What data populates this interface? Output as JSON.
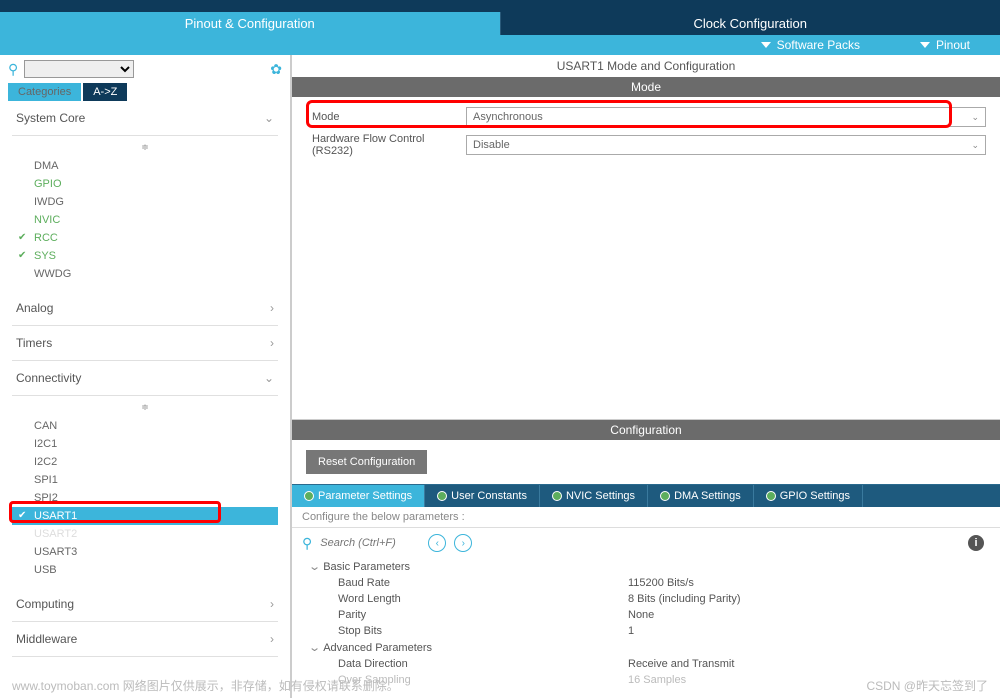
{
  "tabs": {
    "pinout": "Pinout & Configuration",
    "clock": "Clock Configuration"
  },
  "subbar": {
    "packs": "Software Packs",
    "pinout": "Pinout"
  },
  "viewtabs": {
    "categories": "Categories",
    "az": "A->Z"
  },
  "tree": {
    "system_core": "System Core",
    "items_sc": {
      "dma": "DMA",
      "gpio": "GPIO",
      "iwdg": "IWDG",
      "nvic": "NVIC",
      "rcc": "RCC",
      "sys": "SYS",
      "wwdg": "WWDG"
    },
    "analog": "Analog",
    "timers": "Timers",
    "connectivity": "Connectivity",
    "items_conn": {
      "can": "CAN",
      "i2c1": "I2C1",
      "i2c2": "I2C2",
      "spi1": "SPI1",
      "spi2": "SPI2",
      "usart1": "USART1",
      "usart2": "USART2",
      "usart3": "USART3",
      "usb": "USB"
    },
    "computing": "Computing",
    "middleware": "Middleware"
  },
  "right": {
    "title": "USART1 Mode and Configuration",
    "mode": "Mode",
    "mode_label": "Mode",
    "mode_value": "Asynchronous",
    "hw_label": "Hardware Flow Control (RS232)",
    "hw_value": "Disable",
    "config": "Configuration",
    "reset": "Reset Configuration",
    "ctabs": {
      "param": "Parameter Settings",
      "user": "User Constants",
      "nvic": "NVIC Settings",
      "dma": "DMA Settings",
      "gpio": "GPIO Settings"
    },
    "hint": "Configure the below parameters :",
    "search_ph": "Search (Ctrl+F)",
    "basic": "Basic Parameters",
    "baud_l": "Baud Rate",
    "baud_v": "115200 Bits/s",
    "wlen_l": "Word Length",
    "wlen_v": "8 Bits (including Parity)",
    "par_l": "Parity",
    "par_v": "None",
    "stop_l": "Stop Bits",
    "stop_v": "1",
    "adv": "Advanced Parameters",
    "dir_l": "Data Direction",
    "dir_v": "Receive and Transmit",
    "ovs_l": "Over Sampling",
    "ovs_v": "16 Samples"
  },
  "footer": {
    "left": "www.toymoban.com  网络图片仅供展示，非存储，如有侵权请联系删除。",
    "right": "CSDN @昨天忘签到了"
  }
}
